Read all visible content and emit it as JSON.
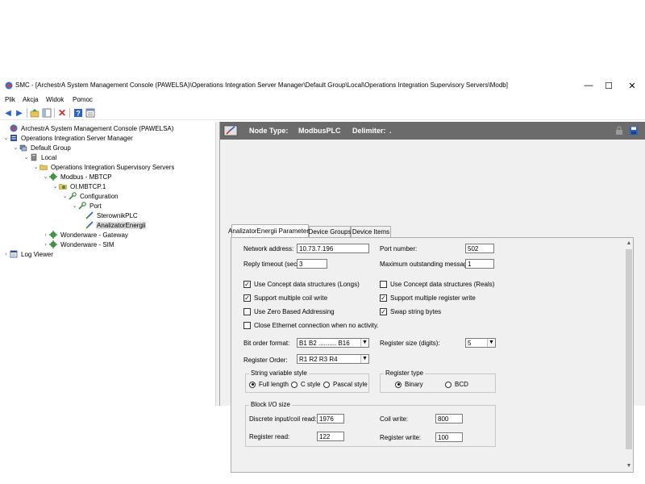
{
  "window": {
    "title": "SMC - [ArchestrA System Management Console (PAWELSA)\\Operations Integration Server Manager\\Default Group\\Local\\Operations Integration Supervisory Servers\\Modb]",
    "minimize": "—",
    "maximize": "☐",
    "close": "✕"
  },
  "menu": [
    "Plik",
    "Akcja",
    "Widok",
    "Pomoc"
  ],
  "tree": [
    {
      "label": "ArchestrA System Management Console (PAWELSA)",
      "level": 0,
      "expander": "",
      "icon": "console-icon"
    },
    {
      "label": "Operations Integration Server Manager",
      "level": 0,
      "expander": "⌄",
      "icon": "server-manager-icon"
    },
    {
      "label": "Default Group",
      "level": 1,
      "expander": "⌄",
      "icon": "group-icon"
    },
    {
      "label": "Local",
      "level": 2,
      "expander": "⌄",
      "icon": "computer-icon"
    },
    {
      "label": "Operations Integration Supervisory Servers",
      "level": 3,
      "expander": "⌄",
      "icon": "folder-icon"
    },
    {
      "label": "Modbus - MBTCP",
      "level": 4,
      "expander": "⌄",
      "icon": "gear-icon"
    },
    {
      "label": "OI.MBTCP.1",
      "level": 5,
      "expander": "⌄",
      "icon": "gear-folder-icon"
    },
    {
      "label": "Configuration",
      "level": 6,
      "expander": "⌄",
      "icon": "config-icon"
    },
    {
      "label": "Port",
      "level": 7,
      "expander": "⌄",
      "icon": "port-icon"
    },
    {
      "label": "SterownikPLC",
      "level": 8,
      "expander": "",
      "icon": "device-icon"
    },
    {
      "label": "AnalizatorEnergii",
      "level": 8,
      "expander": "",
      "icon": "device-icon",
      "selected": true
    },
    {
      "label": "Wonderware - Gateway",
      "level": 4,
      "expander": "›",
      "icon": "gear-icon"
    },
    {
      "label": "Wonderware - SIM",
      "level": 4,
      "expander": "›",
      "icon": "gear-icon"
    },
    {
      "label": "Log Viewer",
      "level": 0,
      "expander": "›",
      "icon": "log-viewer-icon"
    }
  ],
  "header": {
    "node_type_label": "Node Type:",
    "node_type_value": "ModbusPLC",
    "delimiter_label": "Delimiter:",
    "delimiter_value": "."
  },
  "tabs": [
    {
      "label": "AnalizatorEnergii Parameters",
      "active": true
    },
    {
      "label": "Device Groups",
      "active": false
    },
    {
      "label": "Device Items",
      "active": false
    }
  ],
  "form": {
    "network_address_label": "Network address:",
    "network_address_value": "10.73.7.196",
    "port_number_label": "Port number:",
    "port_number_value": "502",
    "reply_timeout_label": "Reply timeout (sec):",
    "reply_timeout_value": "3",
    "max_outstanding_label": "Maximum outstanding messages:",
    "max_outstanding_value": "1",
    "cb_concept_longs": {
      "label": "Use Concept data structures (Longs)",
      "checked": true
    },
    "cb_concept_reals": {
      "label": "Use Concept data structures (Reals)",
      "checked": false
    },
    "cb_multi_coil": {
      "label": "Support multiple coil write",
      "checked": true
    },
    "cb_multi_register": {
      "label": "Support multiple register write",
      "checked": true
    },
    "cb_zero_based": {
      "label": "Use Zero Based Addressing",
      "checked": false
    },
    "cb_swap_bytes": {
      "label": "Swap string bytes",
      "checked": true
    },
    "cb_close_ethernet": {
      "label": "Close Ethernet connection when no activity.",
      "checked": false
    },
    "bit_order_label": "Bit order format:",
    "bit_order_value": "B1  B2  ..........  B16",
    "register_size_label": "Register size (digits):",
    "register_size_value": "5",
    "register_order_label": "Register Order:",
    "register_order_value": "R1 R2 R3 R4",
    "string_style_title": "String variable style",
    "rb_full_length": {
      "label": "Full length",
      "checked": true
    },
    "rb_c_style": {
      "label": "C style",
      "checked": false
    },
    "rb_pascal_style": {
      "label": "Pascal style",
      "checked": false
    },
    "register_type_title": "Register type",
    "rb_binary": {
      "label": "Binary",
      "checked": true
    },
    "rb_bcd": {
      "label": "BCD",
      "checked": false
    },
    "block_io_title": "Block I/O size",
    "discrete_read_label": "Discrete input/coil read:",
    "discrete_read_value": "1976",
    "coil_write_label": "Coil write:",
    "coil_write_value": "800",
    "register_read_label": "Register read:",
    "register_read_value": "122",
    "register_write_label": "Register write:",
    "register_write_value": "100"
  },
  "colors": {
    "header_bar": "#6b6b6b",
    "panel_bg": "#f0f0f0",
    "selection": "#dcdcdc"
  }
}
